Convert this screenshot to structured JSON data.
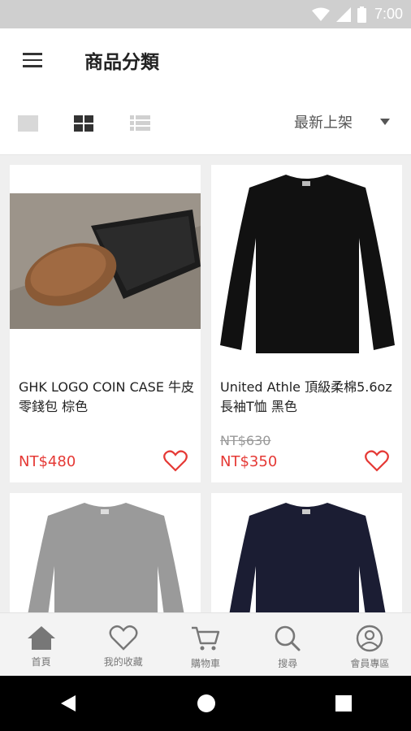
{
  "status_bar": {
    "time": "7:00"
  },
  "app_bar": {
    "title": "商品分類"
  },
  "toolbar": {
    "view_modes": [
      "single",
      "grid",
      "list"
    ],
    "selected_view": "grid",
    "sort_label": "最新上架"
  },
  "products": [
    {
      "name": "GHK LOGO COIN CASE 牛皮零錢包 棕色",
      "original_price": "",
      "price": "NT$480",
      "image": "coin-case-photo"
    },
    {
      "name": "United Athle 頂級柔棉5.6oz 長袖T恤 黑色",
      "original_price": "NT$630",
      "price": "NT$350",
      "image": "black-longsleeve-tee"
    },
    {
      "name": "",
      "original_price": "",
      "price": "",
      "image": "grey-longsleeve-tee"
    },
    {
      "name": "",
      "original_price": "",
      "price": "",
      "image": "navy-longsleeve-tee"
    }
  ],
  "bottom_nav": [
    {
      "label": "首頁",
      "icon": "home-icon"
    },
    {
      "label": "我的收藏",
      "icon": "heart-icon"
    },
    {
      "label": "購物車",
      "icon": "cart-icon"
    },
    {
      "label": "搜尋",
      "icon": "search-icon"
    },
    {
      "label": "會員專區",
      "icon": "user-icon"
    }
  ],
  "colors": {
    "price": "#e53935",
    "nav_active": "#777777",
    "status_bar": "#cfcfcf"
  }
}
